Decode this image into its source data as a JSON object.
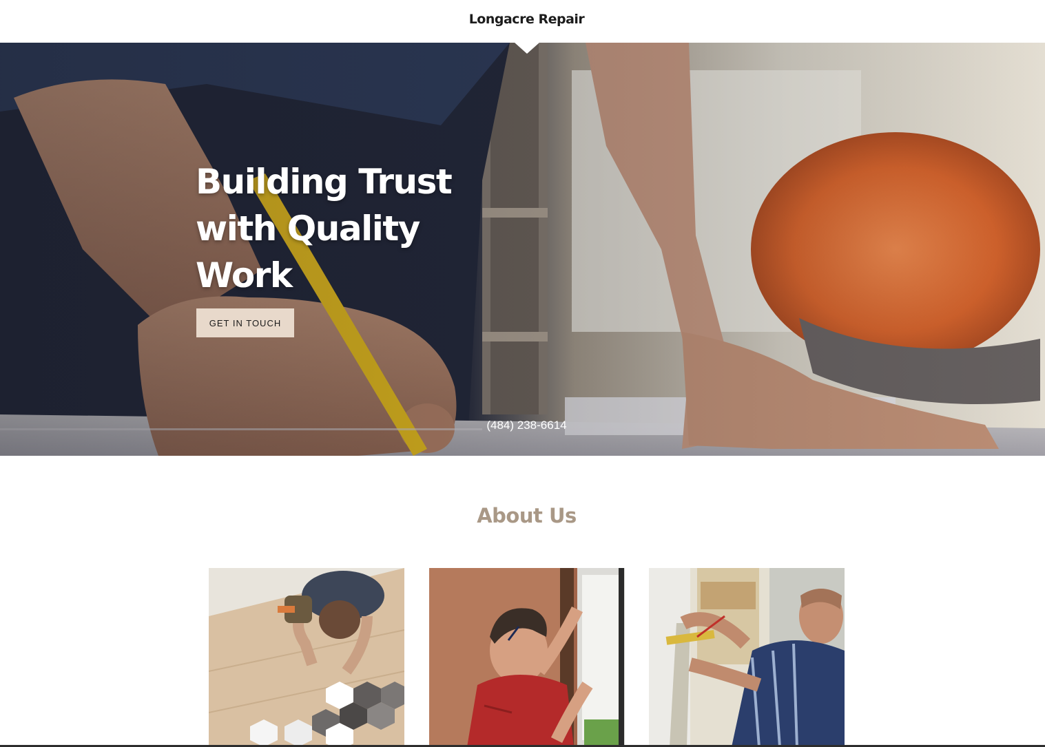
{
  "header": {
    "site_title": "Longacre Repair"
  },
  "hero": {
    "heading": "Building Trust with Quality Work",
    "cta_label": "GET IN TOUCH",
    "phone": "(484) 238-6614"
  },
  "about": {
    "title": "About Us"
  },
  "colors": {
    "cta_background": "#e8d9cb",
    "about_title": "#a99886",
    "hero_text": "#ffffff"
  }
}
